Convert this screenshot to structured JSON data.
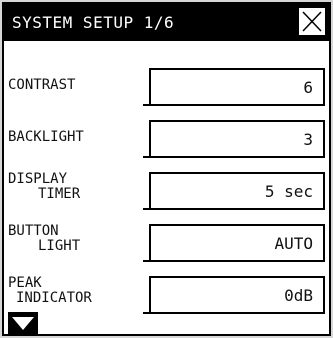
{
  "window": {
    "title": "SYSTEM SETUP 1/6"
  },
  "settings": [
    {
      "label_line1": "CONTRAST",
      "label_line2": "",
      "value": "6"
    },
    {
      "label_line1": "BACKLIGHT",
      "label_line2": "",
      "value": "3"
    },
    {
      "label_line1": "DISPLAY",
      "label_line2": "TIMER",
      "value": "5 sec"
    },
    {
      "label_line1": "BUTTON",
      "label_line2": "LIGHT",
      "value": "AUTO"
    },
    {
      "label_line1": "PEAK",
      "label_line2": "INDICATOR",
      "value": "0dB"
    }
  ],
  "icons": {
    "close": "close-icon",
    "scroll": "triangle-down-icon"
  },
  "colors": {
    "background": "#ffffff",
    "foreground": "#000000",
    "frame": "#d6d6d6"
  }
}
